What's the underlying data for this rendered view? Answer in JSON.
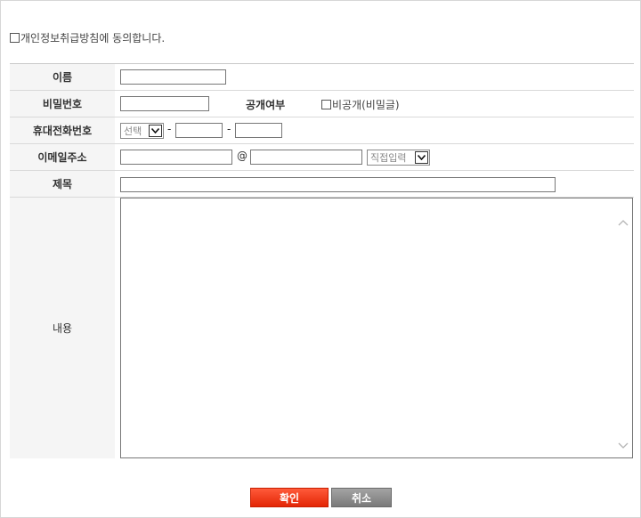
{
  "agreement": {
    "label": "개인정보취급방침에 동의합니다."
  },
  "form": {
    "name_label": "이름",
    "password_label": "비밀번호",
    "public_label": "공개여부",
    "secret_option_label": "비공개(비밀글)",
    "phone_label": "휴대전화번호",
    "phone_select_value": "선택",
    "phone_separator": "-",
    "email_label": "이메일주소",
    "email_at": "@",
    "email_domain_select_value": "직접입력",
    "subject_label": "제목",
    "content_label": "내용"
  },
  "buttons": {
    "confirm": "확인",
    "cancel": "취소"
  },
  "colors": {
    "confirm_button": "#e83a14",
    "cancel_button": "#8c8c8c",
    "label_background": "#f5f5f5"
  }
}
